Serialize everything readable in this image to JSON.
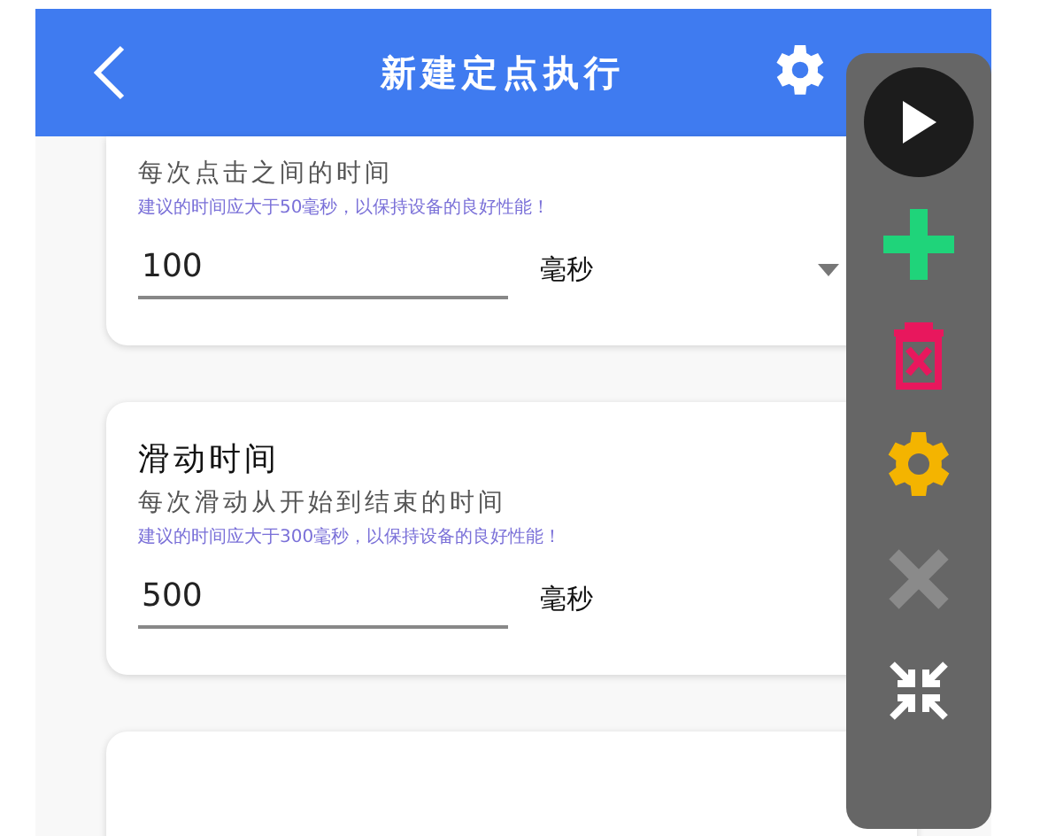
{
  "header": {
    "title": "新建定点执行"
  },
  "cards": [
    {
      "description": "每次点击之间的时间",
      "hint": "建议的时间应大于50毫秒，以保持设备的良好性能！",
      "value": "100",
      "unit": "毫秒",
      "has_dropdown": true
    },
    {
      "title": "滑动时间",
      "description": "每次滑动从开始到结束的时间",
      "hint": "建议的时间应大于300毫秒，以保持设备的良好性能！",
      "value": "500",
      "unit": "毫秒",
      "has_dropdown": false
    }
  ],
  "floating_toolbar": {
    "tools": [
      {
        "kind": "play",
        "disabled": false
      },
      {
        "kind": "add",
        "disabled": false
      },
      {
        "kind": "delete",
        "disabled": false
      },
      {
        "kind": "settings",
        "disabled": false
      },
      {
        "kind": "close",
        "disabled": true
      },
      {
        "kind": "collapse",
        "disabled": false
      }
    ]
  }
}
